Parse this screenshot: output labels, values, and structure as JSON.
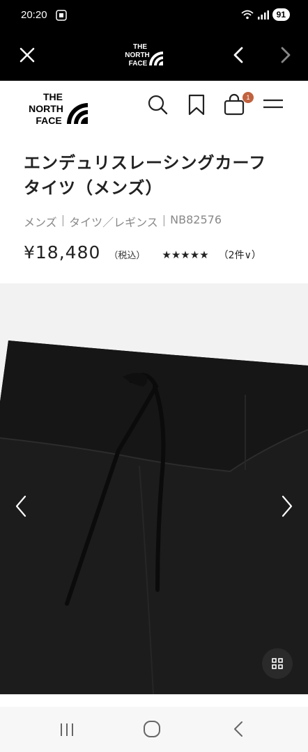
{
  "status_bar": {
    "time": "20:20",
    "battery": "91"
  },
  "browser": {
    "logo_text": "THE NORTH FACE"
  },
  "site_header": {
    "logo_text": "THE NORTH FACE",
    "cart_count": "1"
  },
  "product": {
    "title": "エンデュリスレーシングカーフタイツ（メンズ）",
    "breadcrumb": [
      "メンズ",
      "タイツ／レギンス",
      "NB82576"
    ],
    "price": "¥18,480",
    "tax_label": "（税込）",
    "rating_stars": "★★★★★",
    "reviews": "（2件",
    "reviews_chevron": "∨）"
  },
  "colors": {
    "browser_bar": "#000000",
    "cart_badge": "#c1623f",
    "gallery_bg": "#f2f2f2",
    "garment": "#1c1c1c"
  },
  "icons": {
    "browser_close": "close-icon",
    "browser_back": "chevron-left-icon",
    "browser_forward": "chevron-right-icon",
    "search": "search-icon",
    "bookmark": "bookmark-icon",
    "cart": "shopping-bag-icon",
    "menu": "hamburger-menu-icon",
    "gallery_prev": "chevron-left-icon",
    "gallery_next": "chevron-right-icon",
    "gallery_grid": "grid-icon"
  }
}
